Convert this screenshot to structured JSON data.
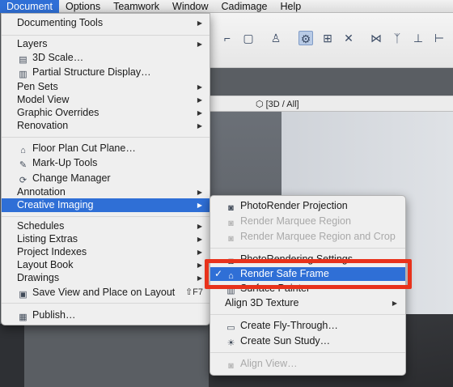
{
  "menubar": {
    "items": [
      "Document",
      "Options",
      "Teamwork",
      "Window",
      "Cadimage",
      "Help"
    ]
  },
  "view_tab": {
    "label": "[3D / All]"
  },
  "document_menu": {
    "items": [
      {
        "label": "Documenting Tools",
        "submenu": true
      },
      {
        "label": "Layers",
        "submenu": true
      },
      {
        "label": "3D Scale…",
        "icon": "scale-icon"
      },
      {
        "label": "Partial Structure Display…",
        "icon": "structure-display-icon"
      },
      {
        "label": "Pen Sets",
        "submenu": true
      },
      {
        "label": "Model View",
        "submenu": true
      },
      {
        "label": "Graphic Overrides",
        "submenu": true
      },
      {
        "label": "Renovation",
        "submenu": true
      },
      {
        "label": "Floor Plan Cut Plane…",
        "icon": "cut-plane-icon"
      },
      {
        "label": "Mark-Up Tools",
        "icon": "markup-icon"
      },
      {
        "label": "Change Manager",
        "icon": "change-manager-icon"
      },
      {
        "label": "Annotation",
        "submenu": true
      },
      {
        "label": "Creative Imaging",
        "submenu": true,
        "highlighted": true
      },
      {
        "label": "Schedules",
        "submenu": true
      },
      {
        "label": "Listing Extras",
        "submenu": true
      },
      {
        "label": "Project Indexes",
        "submenu": true
      },
      {
        "label": "Layout Book",
        "submenu": true
      },
      {
        "label": "Drawings",
        "submenu": true
      },
      {
        "label": "Save View and Place on Layout",
        "icon": "save-view-icon",
        "shortcut": "⇧F7"
      },
      {
        "label": "Publish…",
        "icon": "publish-icon"
      }
    ]
  },
  "creative_imaging_menu": {
    "items": [
      {
        "label": "PhotoRender Projection",
        "icon": "camera-icon"
      },
      {
        "label": "Render Marquee Region",
        "icon": "marquee-icon",
        "disabled": true
      },
      {
        "label": "Render Marquee Region and Crop",
        "icon": "marquee-crop-icon",
        "disabled": true
      },
      {
        "label": "PhotoRendering Settings…",
        "icon": "render-settings-icon"
      },
      {
        "label": "Render Safe Frame",
        "icon": "safe-frame-icon",
        "checked": true,
        "highlighted": true
      },
      {
        "label": "Surface Painter",
        "icon": "surface-painter-icon"
      },
      {
        "label": "Align 3D Texture",
        "submenu": true
      },
      {
        "label": "Create Fly-Through…",
        "icon": "fly-through-icon"
      },
      {
        "label": "Create Sun Study…",
        "icon": "sun-study-icon"
      },
      {
        "label": "Align View…",
        "icon": "align-view-icon",
        "disabled": true
      }
    ]
  },
  "colors": {
    "highlight": "#2f6fd6",
    "callout": "#e8321b"
  }
}
